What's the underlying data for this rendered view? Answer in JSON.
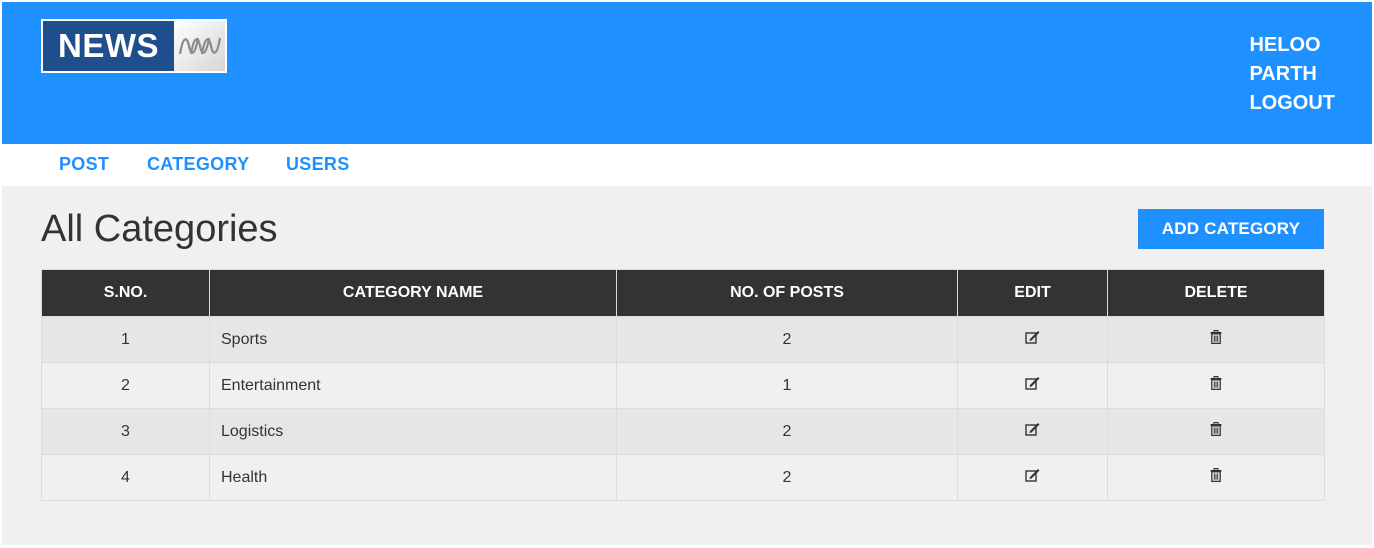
{
  "brand": {
    "logo_text": "NEWS"
  },
  "header": {
    "user_lines": [
      "HELOO",
      "PARTH",
      "LOGOUT"
    ]
  },
  "nav": {
    "items": [
      "POST",
      "CATEGORY",
      "USERS"
    ]
  },
  "page": {
    "title": "All Categories",
    "add_button_label": "ADD CATEGORY"
  },
  "table": {
    "columns": [
      "S.NO.",
      "CATEGORY NAME",
      "NO. OF POSTS",
      "EDIT",
      "DELETE"
    ],
    "rows": [
      {
        "sno": "1",
        "name": "Sports",
        "posts": "2"
      },
      {
        "sno": "2",
        "name": "Entertainment",
        "posts": "1"
      },
      {
        "sno": "3",
        "name": "Logistics",
        "posts": "2"
      },
      {
        "sno": "4",
        "name": "Health",
        "posts": "2"
      }
    ]
  },
  "icons": {
    "edit": "edit-icon",
    "delete": "trash-icon"
  },
  "colors": {
    "primary": "#1e90ff",
    "table_header": "#333333",
    "page_bg": "#f0f0f0",
    "logo_bg": "#1e4e8c"
  }
}
